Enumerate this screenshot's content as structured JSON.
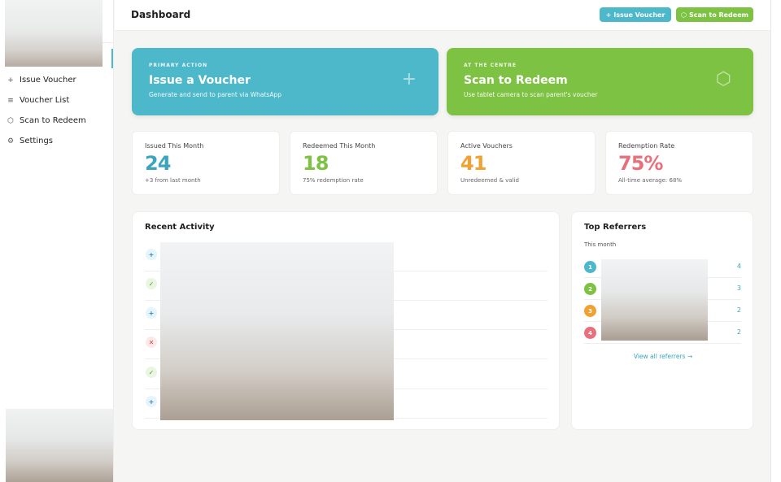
{
  "sidebar": {
    "items": [
      {
        "label": "Issue Voucher",
        "icon": "+"
      },
      {
        "label": "Voucher List",
        "icon": "≡"
      },
      {
        "label": "Scan to Redeem",
        "icon": "⬡"
      },
      {
        "label": "Settings",
        "icon": "⚙"
      }
    ]
  },
  "header": {
    "title": "Dashboard",
    "issue_button": "Issue Voucher",
    "scan_button": "Scan to Redeem"
  },
  "actions": {
    "issue": {
      "eyebrow": "PRIMARY ACTION",
      "title": "Issue a Voucher",
      "subtitle": "Generate and send to parent via WhatsApp"
    },
    "scan": {
      "eyebrow": "AT THE CENTRE",
      "title": "Scan to Redeem",
      "subtitle": "Use tablet camera to scan parent's voucher"
    }
  },
  "stats": [
    {
      "label": "Issued This Month",
      "value": "24",
      "note": "+3 from last month",
      "color": "#3aa5bd"
    },
    {
      "label": "Redeemed This Month",
      "value": "18",
      "note": "75% redemption rate",
      "color": "#7dc243"
    },
    {
      "label": "Active Vouchers",
      "value": "41",
      "note": "Unredeemed & valid",
      "color": "#f0a132"
    },
    {
      "label": "Redemption Rate",
      "value": "75%",
      "note": "All-time average: 68%",
      "color": "#e8707c"
    }
  ],
  "activity": {
    "title": "Recent Activity",
    "rows": [
      {
        "type": "issue",
        "glyph": "+"
      },
      {
        "type": "redeem",
        "glyph": "✓"
      },
      {
        "type": "issue",
        "glyph": "+"
      },
      {
        "type": "void",
        "glyph": "✕"
      },
      {
        "type": "redeem",
        "glyph": "✓"
      },
      {
        "type": "issue",
        "glyph": "+"
      }
    ]
  },
  "referrers": {
    "title": "Top Referrers",
    "subtitle": "This month",
    "rows": [
      {
        "rank": "1",
        "count": "4",
        "color": "#4db8c9"
      },
      {
        "rank": "2",
        "count": "3",
        "color": "#7dc243"
      },
      {
        "rank": "3",
        "count": "2",
        "color": "#f0a132"
      },
      {
        "rank": "4",
        "count": "2",
        "color": "#e8707c"
      }
    ],
    "view_all": "View all referrers →"
  }
}
